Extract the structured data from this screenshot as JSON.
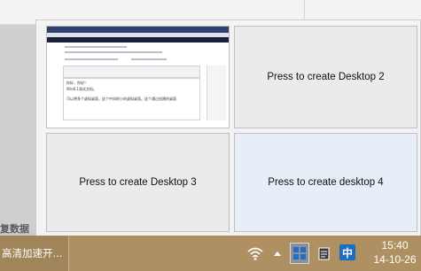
{
  "background": {
    "side_text": "复数据"
  },
  "desktops": [
    {
      "label": ""
    },
    {
      "label": "Press to create Desktop 2"
    },
    {
      "label": "Press to create Desktop 3"
    },
    {
      "label": "Press to create desktop 4"
    }
  ],
  "thumbnail": {
    "line1": "你好，你好！",
    "line2": "Win8.1测试文档。",
    "line3": "可以将多个虚拟桌面，这个中间的小的虚拟桌面。这个通过创建的桌面"
  },
  "taskbar": {
    "app_label": "高清加速开...",
    "ime_label": "中",
    "time": "15:40",
    "date": "14-10-26",
    "colors": {
      "taskbar": "#ae9063",
      "active_desktop_icon": "#1f6fc8"
    }
  }
}
